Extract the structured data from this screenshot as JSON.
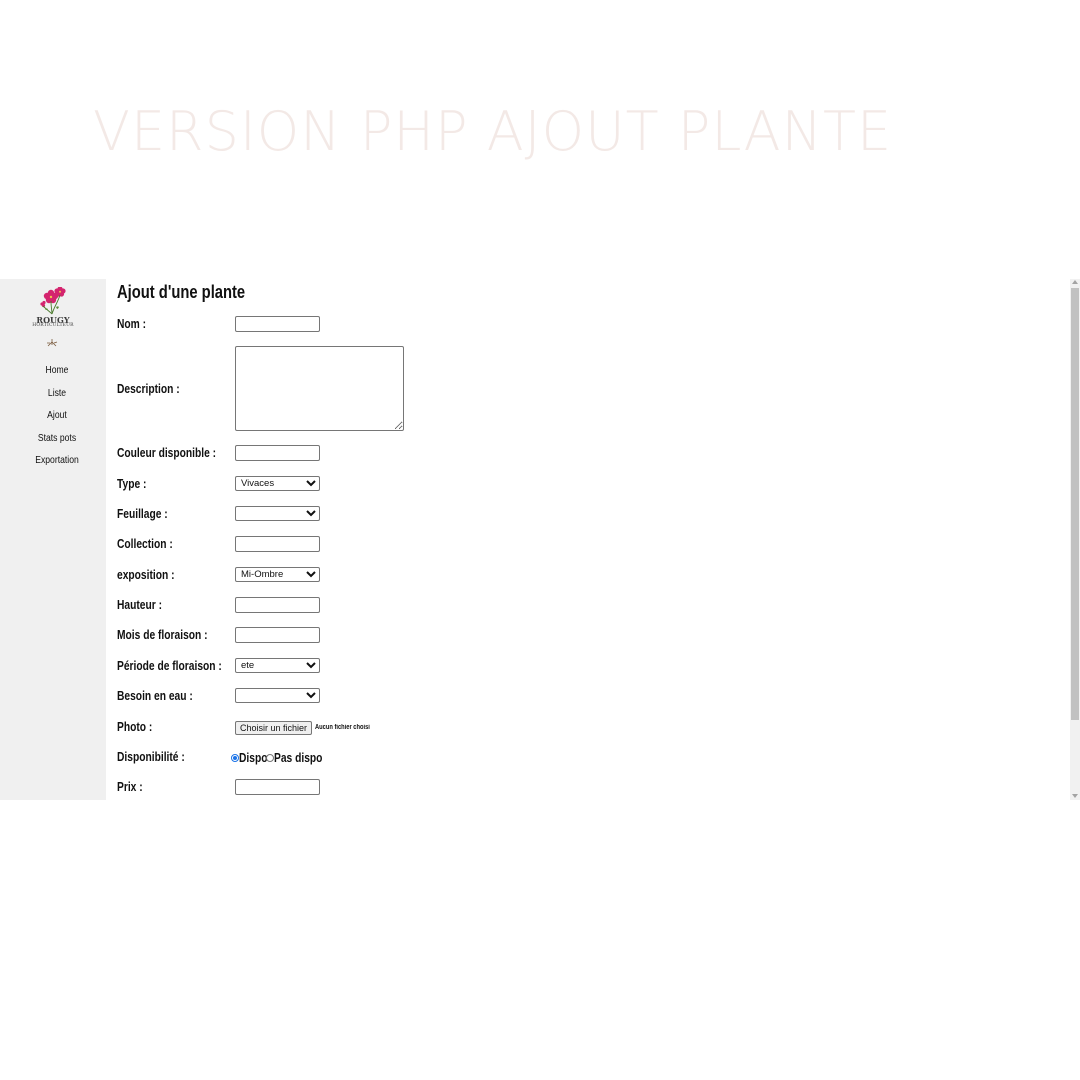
{
  "banner": {
    "text": "VERSION PHP AJOUT PLANTE"
  },
  "sidebar": {
    "logo": {
      "name": "ROUGY",
      "subtitle": "HORTICULTEUR"
    },
    "items": [
      {
        "label": "Home"
      },
      {
        "label": "Liste"
      },
      {
        "label": "Ajout"
      },
      {
        "label": "Stats pots"
      },
      {
        "label": "Exportation"
      }
    ]
  },
  "form": {
    "title": "Ajout d'une plante",
    "nom": {
      "label": "Nom :",
      "value": ""
    },
    "description": {
      "label": "Description :",
      "value": ""
    },
    "couleur": {
      "label": "Couleur disponible :",
      "value": ""
    },
    "type": {
      "label": "Type :",
      "selected": "Vivaces"
    },
    "feuillage": {
      "label": "Feuillage :",
      "selected": ""
    },
    "collection": {
      "label": "Collection :",
      "value": ""
    },
    "exposition": {
      "label": "exposition :",
      "selected": "Mi-Ombre"
    },
    "hauteur": {
      "label": "Hauteur :",
      "value": ""
    },
    "mois_floraison": {
      "label": "Mois de floraison :",
      "value": ""
    },
    "periode_floraison": {
      "label": "Période de floraison :",
      "selected": "ete"
    },
    "besoin_eau": {
      "label": "Besoin en eau :",
      "selected": ""
    },
    "photo": {
      "label": "Photo :",
      "button": "Choisir un fichier",
      "status": "Aucun fichier choisi"
    },
    "disponibilite": {
      "label": "Disponibilité :",
      "options": [
        "Dispo",
        "Pas dispo"
      ],
      "selected": "Dispo"
    },
    "prix": {
      "label": "Prix :",
      "value": ""
    }
  },
  "colors": {
    "banner": "#f3e9e6",
    "sidebar_bg": "#f0f0f0",
    "radio_accent": "#1a73e8"
  }
}
